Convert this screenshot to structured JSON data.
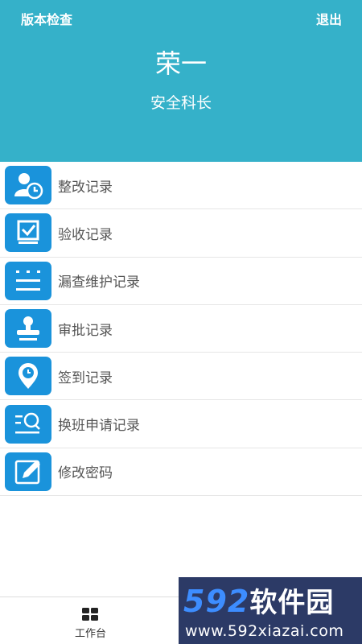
{
  "header": {
    "version_check": "版本检查",
    "logout": "退出",
    "user_name": "荣一",
    "user_role": "安全科长",
    "bg_color": "#35b1c9"
  },
  "menu": {
    "icon_color": "#1a93db",
    "items": [
      {
        "label": "整改记录",
        "icon": "user-clock-icon"
      },
      {
        "label": "验收记录",
        "icon": "checkbox-icon"
      },
      {
        "label": "漏查维护记录",
        "icon": "list-icon"
      },
      {
        "label": "审批记录",
        "icon": "stamp-icon"
      },
      {
        "label": "签到记录",
        "icon": "location-pin-icon"
      },
      {
        "label": "换班申请记录",
        "icon": "search-list-icon"
      },
      {
        "label": "修改密码",
        "icon": "edit-icon"
      }
    ]
  },
  "tabbar": {
    "workbench_label": "工作台",
    "workbench_icon": "grid-icon"
  },
  "watermark": {
    "title_num": "592",
    "title_cn": "软件园",
    "url": "www.592xiazai.com"
  }
}
